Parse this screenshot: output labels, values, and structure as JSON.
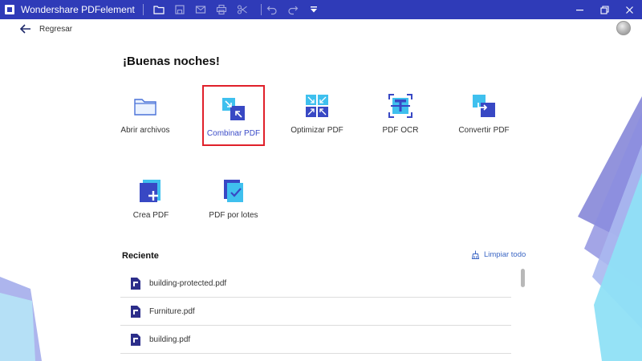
{
  "app": {
    "title": "Wondershare PDFelement"
  },
  "nav": {
    "back_label": "Regresar"
  },
  "home": {
    "greeting": "¡Buenas noches!"
  },
  "actions": [
    {
      "label": "Abrir archivos",
      "icon": "folder-icon"
    },
    {
      "label": "Combinar PDF",
      "icon": "combine-pdf-icon",
      "selected": true
    },
    {
      "label": "Optimizar PDF",
      "icon": "optimize-pdf-icon"
    },
    {
      "label": "PDF OCR",
      "icon": "ocr-icon"
    },
    {
      "label": "Convertir PDF",
      "icon": "convert-pdf-icon"
    },
    {
      "label": "Crea PDF",
      "icon": "create-pdf-icon"
    },
    {
      "label": "PDF por lotes",
      "icon": "batch-pdf-icon"
    }
  ],
  "recent": {
    "title": "Reciente",
    "clear_label": "Limpiar todo",
    "files": [
      {
        "name": "building-protected.pdf"
      },
      {
        "name": "Furniture.pdf"
      },
      {
        "name": "building.pdf"
      }
    ]
  },
  "colors": {
    "titlebar": "#2f3bb8",
    "accent": "#3b4cc8",
    "highlight_border": "#e0202a"
  }
}
